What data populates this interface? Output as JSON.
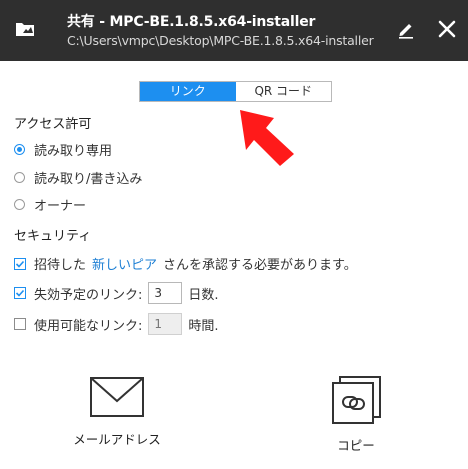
{
  "header": {
    "title": "共有 - MPC-BE.1.8.5.x64-installer",
    "path": "C:\\Users\\vmpc\\Desktop\\MPC-BE.1.8.5.x64-installer",
    "logo_icon": "folder-share-icon",
    "edit_icon": "pencil-icon",
    "close_icon": "close-icon",
    "bg_color": "#2f2f2f"
  },
  "tabs": [
    {
      "label": "リンク",
      "active": true
    },
    {
      "label": "QR コード",
      "active": false
    }
  ],
  "access": {
    "heading": "アクセス許可",
    "options": [
      {
        "label": "読み取り専用",
        "selected": true
      },
      {
        "label": "読み取り/書き込み",
        "selected": false
      },
      {
        "label": "オーナー",
        "selected": false
      }
    ]
  },
  "security": {
    "heading": "セキュリティ",
    "approve": {
      "prefix": "招待した",
      "link": "新しいピア",
      "suffix": "さんを承認する必要があります。",
      "checked": true
    },
    "expire": {
      "prefix": "失効予定のリンク:",
      "value": "3",
      "suffix": "日数.",
      "checked": true
    },
    "usable": {
      "prefix": "使用可能なリンク:",
      "value": "1",
      "suffix": "時間.",
      "checked": false
    }
  },
  "actions": {
    "email": {
      "label": "メールアドレス",
      "icon": "envelope-icon"
    },
    "copy": {
      "label": "コピー",
      "icon": "copy-link-icon"
    }
  },
  "accent_color": "#1d8ff0",
  "annotation_arrow_color": "#ff1a1a"
}
